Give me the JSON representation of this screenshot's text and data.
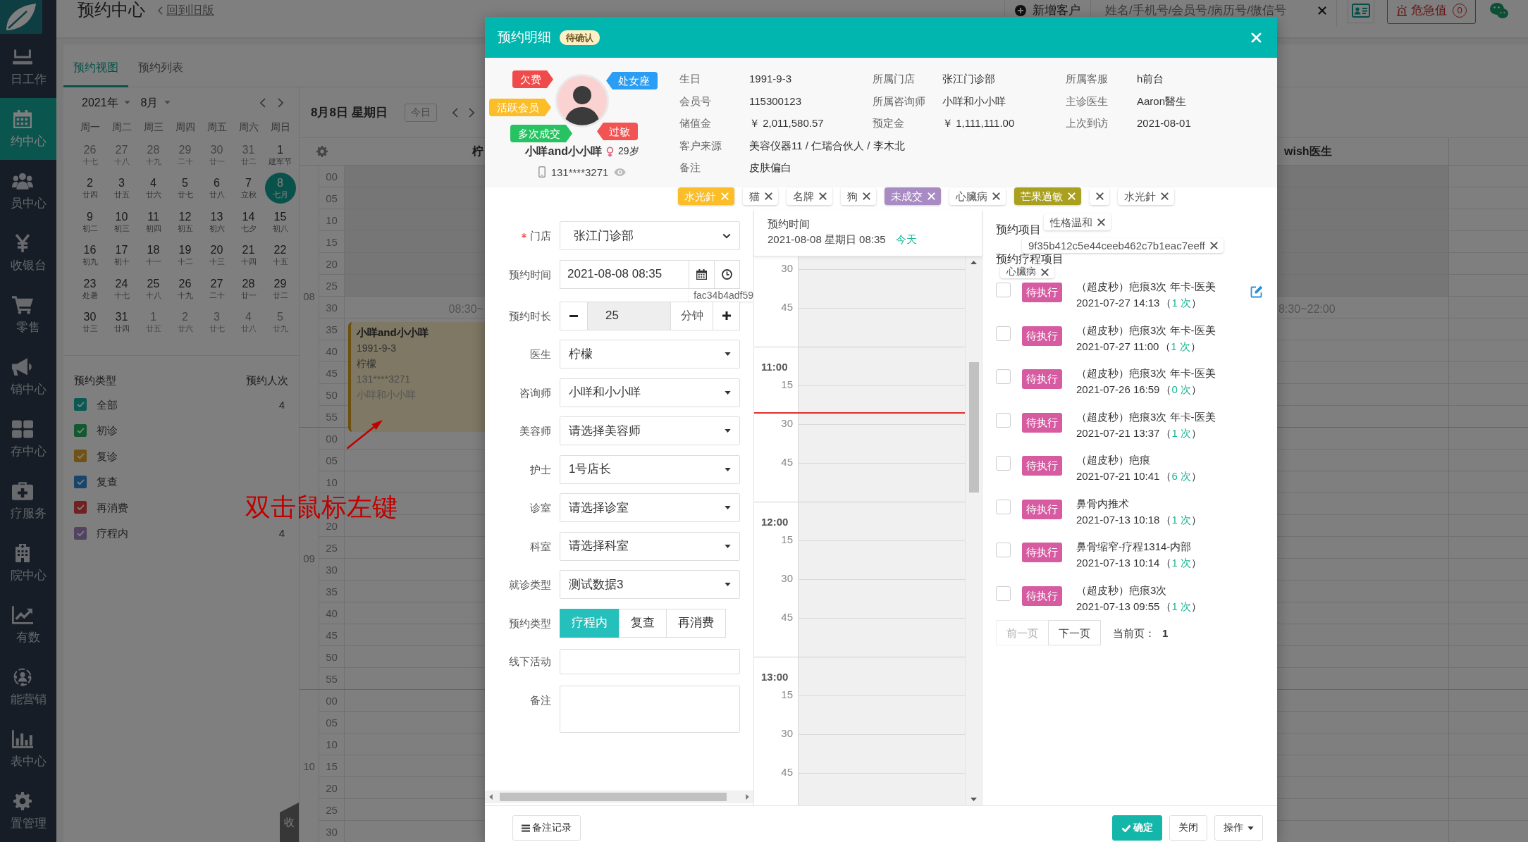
{
  "sidebar": {
    "items": [
      {
        "label": "日工作",
        "selected": false
      },
      {
        "label": "约中心",
        "selected": true
      },
      {
        "label": "员中心",
        "selected": false
      },
      {
        "label": "收银台",
        "selected": false
      },
      {
        "label": "零售",
        "selected": false
      },
      {
        "label": "销中心",
        "selected": false
      },
      {
        "label": "存中心",
        "selected": false
      },
      {
        "label": "疗服务",
        "selected": false
      },
      {
        "label": "院中心",
        "selected": false
      },
      {
        "label": "有数",
        "selected": false
      },
      {
        "label": "能营销",
        "selected": false
      },
      {
        "label": "表中心",
        "selected": false
      },
      {
        "label": "置管理",
        "selected": false
      }
    ]
  },
  "header": {
    "title": "预约中心",
    "back_link": "回到旧版",
    "new_customer_button": "新增客户",
    "search": {
      "placeholder": "姓名/手机号/会员号/病历号/微信号"
    },
    "alert_button": {
      "label": "危急值",
      "count": "0"
    }
  },
  "tabs": [
    {
      "label": "预约视图",
      "selected": true
    },
    {
      "label": "预约列表",
      "selected": false
    }
  ],
  "mini_calendar": {
    "year": "2021年",
    "month": "8月",
    "weekdays": [
      "周一",
      "周二",
      "周三",
      "周四",
      "周五",
      "周六",
      "周日"
    ],
    "weeks": [
      [
        {
          "day": "26",
          "lunar": "十七",
          "outside": true,
          "selected": false
        },
        {
          "day": "27",
          "lunar": "十八",
          "outside": true,
          "selected": false
        },
        {
          "day": "28",
          "lunar": "十九",
          "outside": true,
          "selected": false
        },
        {
          "day": "29",
          "lunar": "二十",
          "outside": true,
          "selected": false
        },
        {
          "day": "30",
          "lunar": "廿一",
          "outside": true,
          "selected": false
        },
        {
          "day": "31",
          "lunar": "廿二",
          "outside": true,
          "selected": false
        },
        {
          "day": "1",
          "lunar": "建军节",
          "outside": false,
          "selected": false
        }
      ],
      [
        {
          "day": "2",
          "lunar": "廿四",
          "outside": false,
          "selected": false
        },
        {
          "day": "3",
          "lunar": "廿五",
          "outside": false,
          "selected": false
        },
        {
          "day": "4",
          "lunar": "廿六",
          "outside": false,
          "selected": false
        },
        {
          "day": "5",
          "lunar": "廿七",
          "outside": false,
          "selected": false
        },
        {
          "day": "6",
          "lunar": "廿八",
          "outside": false,
          "selected": false
        },
        {
          "day": "7",
          "lunar": "立秋",
          "outside": false,
          "selected": false
        },
        {
          "day": "8",
          "lunar": "七月",
          "outside": false,
          "selected": true
        }
      ],
      [
        {
          "day": "9",
          "lunar": "初二",
          "outside": false,
          "selected": false
        },
        {
          "day": "10",
          "lunar": "初三",
          "outside": false,
          "selected": false
        },
        {
          "day": "11",
          "lunar": "初四",
          "outside": false,
          "selected": false
        },
        {
          "day": "12",
          "lunar": "初五",
          "outside": false,
          "selected": false
        },
        {
          "day": "13",
          "lunar": "初六",
          "outside": false,
          "selected": false
        },
        {
          "day": "14",
          "lunar": "七夕",
          "outside": false,
          "selected": false
        },
        {
          "day": "15",
          "lunar": "初八",
          "outside": false,
          "selected": false
        }
      ],
      [
        {
          "day": "16",
          "lunar": "初九",
          "outside": false,
          "selected": false
        },
        {
          "day": "17",
          "lunar": "初十",
          "outside": false,
          "selected": false
        },
        {
          "day": "18",
          "lunar": "十一",
          "outside": false,
          "selected": false
        },
        {
          "day": "19",
          "lunar": "十二",
          "outside": false,
          "selected": false
        },
        {
          "day": "20",
          "lunar": "十三",
          "outside": false,
          "selected": false
        },
        {
          "day": "21",
          "lunar": "十四",
          "outside": false,
          "selected": false
        },
        {
          "day": "22",
          "lunar": "十五",
          "outside": false,
          "selected": false
        }
      ],
      [
        {
          "day": "23",
          "lunar": "处暑",
          "outside": false,
          "selected": false
        },
        {
          "day": "24",
          "lunar": "十七",
          "outside": false,
          "selected": false
        },
        {
          "day": "25",
          "lunar": "十八",
          "outside": false,
          "selected": false
        },
        {
          "day": "26",
          "lunar": "十九",
          "outside": false,
          "selected": false
        },
        {
          "day": "27",
          "lunar": "二十",
          "outside": false,
          "selected": false
        },
        {
          "day": "28",
          "lunar": "廿一",
          "outside": false,
          "selected": false
        },
        {
          "day": "29",
          "lunar": "廿二",
          "outside": false,
          "selected": false
        }
      ],
      [
        {
          "day": "30",
          "lunar": "廿三",
          "outside": false,
          "selected": false
        },
        {
          "day": "31",
          "lunar": "廿四",
          "outside": false,
          "selected": false
        },
        {
          "day": "1",
          "lunar": "廿五",
          "outside": true,
          "selected": false
        },
        {
          "day": "2",
          "lunar": "廿六",
          "outside": true,
          "selected": false
        },
        {
          "day": "3",
          "lunar": "廿七",
          "outside": true,
          "selected": false
        },
        {
          "day": "4",
          "lunar": "廿八",
          "outside": true,
          "selected": false
        },
        {
          "day": "5",
          "lunar": "廿九",
          "outside": true,
          "selected": false
        }
      ]
    ]
  },
  "appointment_types": {
    "title": "预约类型",
    "count_title": "预约人次",
    "items": [
      {
        "label": "全部",
        "count": "4",
        "checked": true,
        "color": "#0b5953"
      },
      {
        "label": "初诊",
        "checked": true,
        "color": "#12592f"
      },
      {
        "label": "复诊",
        "checked": true,
        "color": "#715215"
      },
      {
        "label": "复查",
        "checked": true,
        "color": "#17456b"
      },
      {
        "label": "再消费",
        "checked": true,
        "color": "#702222"
      },
      {
        "label": "疗程内",
        "count": "4",
        "checked": true,
        "color": "#524461"
      }
    ]
  },
  "collapse_tab": "收",
  "day_view": {
    "date": "8月8日 星期日",
    "today_button": {
      "label": "今日",
      "disabled": true
    },
    "columns": [
      {
        "header": "柠",
        "hours_text": "08:30~"
      },
      {
        "header": "wish医生",
        "hours_text": "8:30~22:00"
      }
    ],
    "hours": [
      {
        "label": "08",
        "rows": [
          {
            "label": "00",
            "off": true
          },
          {
            "label": "05",
            "off": true
          },
          {
            "label": "10",
            "off": true
          },
          {
            "label": "15",
            "off": true
          },
          {
            "label": "20",
            "off": true
          },
          {
            "label": "25",
            "off": true
          },
          {
            "label": "30",
            "off": false
          },
          {
            "label": "35",
            "off": false,
            "event": {
              "title": "小咩and小小咩",
              "lines": [
                "1991-9-3",
                "柠檬",
                "131****3271",
                "小咩和小小咩"
              ]
            }
          },
          {
            "label": "40",
            "off": false
          },
          {
            "label": "45",
            "off": false
          },
          {
            "label": "50",
            "off": false
          },
          {
            "label": "55",
            "off": false
          }
        ]
      },
      {
        "label": "09",
        "rows": [
          {
            "label": "00",
            "off": false
          },
          {
            "label": "05",
            "off": false
          },
          {
            "label": "10",
            "off": false
          },
          {
            "off": false
          },
          {
            "label": "20",
            "off": false
          },
          {
            "label": "25",
            "off": false
          },
          {
            "label": "30",
            "off": false
          },
          {
            "label": "35",
            "off": false
          },
          {
            "label": "40",
            "off": false
          },
          {
            "label": "45",
            "off": false
          },
          {
            "label": "50",
            "off": false
          },
          {
            "label": "55",
            "off": false
          }
        ]
      },
      {
        "label": "10",
        "rows": [
          {
            "label": "00",
            "off": false
          },
          {
            "label": "05",
            "off": false
          },
          {
            "label": "10",
            "off": false
          },
          {
            "label": "15",
            "off": false
          },
          {
            "label": "20",
            "off": false
          },
          {
            "label": "25",
            "off": false
          },
          {
            "label": "30",
            "off": false
          }
        ]
      }
    ]
  },
  "annotation": {
    "text": "双击鼠标左键"
  },
  "modal": {
    "title": "预约明细",
    "status": "待确认",
    "customer": {
      "tags": [
        {
          "label": "欠费",
          "color": "#f04b4b"
        },
        {
          "label": "处女座",
          "color": "#2a9df4"
        },
        {
          "label": "活跃会员",
          "color": "#fbbd28"
        },
        {
          "label": "多次成交",
          "color": "#27c262"
        },
        {
          "label": "过敏",
          "color": "#f25353"
        }
      ],
      "name": "小咩and小小咩",
      "age": "29岁",
      "phone": "131****3271"
    },
    "info": [
      [
        {
          "label": "生日",
          "value": "1991-9-3"
        },
        {
          "label": "所属门店",
          "value": "张江门诊部"
        },
        {
          "label": "所属客服",
          "value": "h前台"
        }
      ],
      [
        {
          "label": "会员号",
          "value": "115300123"
        },
        {
          "label": "所属咨询师",
          "value": "小咩和小小咩"
        },
        {
          "label": "主诊医生",
          "value": "Aaron醫生"
        }
      ],
      [
        {
          "label": "储值金",
          "value": "￥ 2,011,580.57"
        },
        {
          "label": "预定金",
          "value": "￥ 1,111,111.00"
        },
        {
          "label": "上次到访",
          "value": "2021-08-01"
        }
      ],
      [
        {
          "label": "客户来源",
          "value": "美容仪器11 / 仁瑞合伙人 / 李木北"
        }
      ],
      [
        {
          "label": "备注",
          "value": "皮肤偏白"
        }
      ]
    ],
    "tags": [
      {
        "label": "水光針",
        "color": "#fbbd28",
        "closable": true
      },
      {
        "label": "猫",
        "closable": true
      },
      {
        "label": "名牌",
        "closable": true
      },
      {
        "label": "狗",
        "closable": true
      },
      {
        "label": "未成交",
        "color": "#a98bc4",
        "closable": true
      },
      {
        "label": "心臟病",
        "closable": true
      },
      {
        "label": "芒果過敏",
        "color": "#a9a01f",
        "closable": true
      },
      {
        "closable": true
      },
      {
        "label": "水光針",
        "closable": true
      }
    ],
    "form": [
      {
        "kind": "dropdown",
        "label": "门店",
        "required": true,
        "value": "张江门诊部"
      },
      {
        "kind": "datetime",
        "label": "预约时间",
        "required": false,
        "value": "2021-08-08 08:35"
      },
      {
        "kind": "tag",
        "text": "fac34b4adf59"
      },
      {
        "kind": "stepper",
        "label": "预约时长",
        "required": false,
        "value": "25",
        "unit": "分钟"
      },
      {
        "kind": "select",
        "label": "医生",
        "required": false,
        "value": "柠檬"
      },
      {
        "kind": "select",
        "label": "咨询师",
        "required": false,
        "value": "小咩和小小咩"
      },
      {
        "kind": "select",
        "label": "美容师",
        "required": false,
        "value": "请选择美容师"
      },
      {
        "kind": "select",
        "label": "护士",
        "required": false,
        "value": "1号店长"
      },
      {
        "kind": "select",
        "label": "诊室",
        "required": false,
        "value": "请选择诊室"
      },
      {
        "kind": "select",
        "label": "科室",
        "required": false,
        "value": "请选择科室"
      },
      {
        "kind": "select",
        "label": "就诊类型",
        "required": false,
        "value": "测试数据3"
      },
      {
        "kind": "segmented",
        "label": "预约类型",
        "required": false,
        "options": [
          {
            "label": "疗程内",
            "selected": true
          },
          {
            "label": "复查",
            "selected": false
          },
          {
            "label": "再消费",
            "selected": false
          }
        ]
      },
      {
        "kind": "text",
        "label": "线下活动",
        "required": false
      },
      {
        "kind": "textarea",
        "label": "备注",
        "required": false
      }
    ],
    "time_popover": {
      "label": "预约时间",
      "value": "2021-08-08 星期日 08:35",
      "badge": "今天"
    },
    "timeline": [
      {
        "label": "30",
        "kind": "minute",
        "now": false
      },
      {
        "label": "45",
        "kind": "minute",
        "now": false
      },
      {
        "label": "11:00",
        "kind": "hour",
        "now": false
      },
      {
        "label": "15",
        "kind": "minute",
        "now": true
      },
      {
        "label": "30",
        "kind": "minute",
        "now": false
      },
      {
        "label": "45",
        "kind": "minute",
        "now": false
      },
      {
        "label": "12:00",
        "kind": "hour",
        "now": false
      },
      {
        "label": "15",
        "kind": "minute",
        "now": false
      },
      {
        "label": "30",
        "kind": "minute",
        "now": false
      },
      {
        "label": "45",
        "kind": "minute",
        "now": false
      },
      {
        "label": "13:00",
        "kind": "hour",
        "now": false
      },
      {
        "label": "15",
        "kind": "minute",
        "now": false
      },
      {
        "label": "30",
        "kind": "minute",
        "now": false
      },
      {
        "label": "45",
        "kind": "minute",
        "now": false
      }
    ],
    "projects": {
      "title": "预约项目",
      "tags": [
        {
          "label": "性格温和",
          "closable": true
        },
        {
          "label": "9f35b412c5e44ceeb462c7b1eac7eeff",
          "closable": true
        }
      ]
    },
    "course": {
      "title": "预约疗程项目",
      "tags": [
        {
          "label": "心臟病",
          "closable": true
        }
      ],
      "items": [
        {
          "status": "待执行",
          "title": "（超皮秒）疤痕3次 年卡-医美",
          "time": "2021-07-27 14:13",
          "count_open": "（",
          "count": "1 次",
          "count_close": "）",
          "checked": false,
          "editable": true
        },
        {
          "status": "待执行",
          "title": "（超皮秒）疤痕3次 年卡-医美",
          "time": "2021-07-27 11:00",
          "count_open": "（",
          "count": "1 次",
          "count_close": "）",
          "checked": false,
          "editable": false
        },
        {
          "status": "待执行",
          "title": "（超皮秒）疤痕3次 年卡-医美",
          "time": "2021-07-26 16:59",
          "count_open": "（",
          "count": "0 次",
          "count_close": "）",
          "checked": false,
          "editable": false
        },
        {
          "status": "待执行",
          "title": "（超皮秒）疤痕3次 年卡-医美",
          "time": "2021-07-21 13:37",
          "count_open": "（",
          "count": "1 次",
          "count_close": "）",
          "checked": false,
          "editable": false
        },
        {
          "status": "待执行",
          "title": "（超皮秒）疤痕",
          "time": "2021-07-21 10:41",
          "count_open": "（",
          "count": "6 次",
          "count_close": "）",
          "checked": false,
          "editable": false
        },
        {
          "status": "待执行",
          "title": "鼻骨内推术",
          "time": "2021-07-13 10:18",
          "count_open": "（",
          "count": "1 次",
          "count_close": "）",
          "checked": false,
          "editable": false
        },
        {
          "status": "待执行",
          "title": "鼻骨缩窄-疗程1314-内部",
          "time": "2021-07-13 10:14",
          "count_open": "（",
          "count": "1 次",
          "count_close": "）",
          "checked": false,
          "editable": false
        },
        {
          "status": "待执行",
          "title": "（超皮秒）疤痕3次",
          "time": "2021-07-13 09:55",
          "count_open": "（",
          "count": "1 次",
          "count_close": "）",
          "checked": false,
          "editable": false
        }
      ],
      "pager": {
        "prev": {
          "label": "前一页",
          "disabled": true
        },
        "next": {
          "label": "下一页",
          "disabled": false
        },
        "current_label": "当前页：",
        "current": "1"
      }
    },
    "footer": {
      "left": [
        {
          "label": "备注记录",
          "kind": "notes"
        }
      ],
      "right": [
        {
          "label": "确定",
          "kind": "primary"
        },
        {
          "label": "关闭",
          "kind": "close"
        },
        {
          "label": "操作",
          "kind": "menu"
        }
      ]
    }
  }
}
